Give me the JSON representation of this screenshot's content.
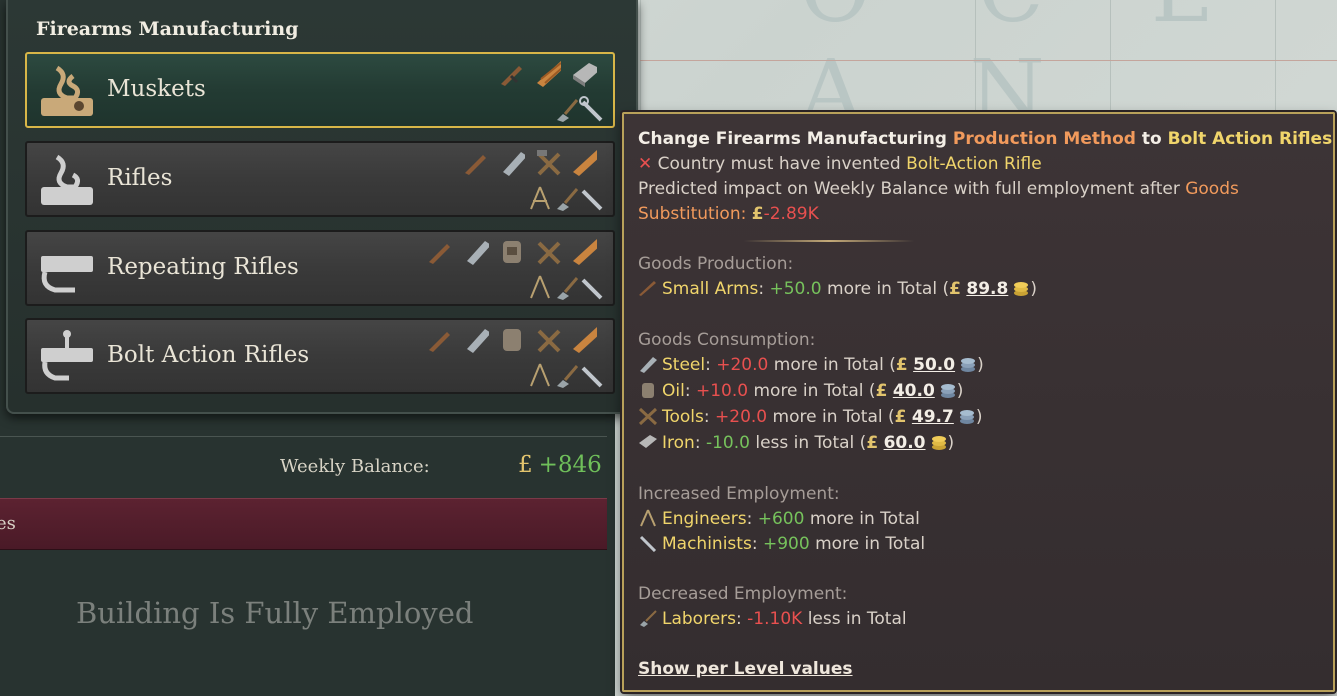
{
  "panel": {
    "title": "Firearms Manufacturing",
    "methods": [
      {
        "label": "Muskets"
      },
      {
        "label": "Rifles"
      },
      {
        "label": "Repeating Rifles"
      },
      {
        "label": "Bolt Action Rifles"
      }
    ]
  },
  "balance": {
    "label": "Weekly Balance:",
    "currency": "£",
    "value": "+846"
  },
  "maroon_text": "es",
  "employment_status": "Building Is Fully Employed",
  "tooltip": {
    "title_prefix": "Change Firearms Manufacturing",
    "title_mid": "Production Method",
    "title_to": "to",
    "title_target": "Bolt Action Rifles",
    "req_prefix": "Country must have invented",
    "req_tech": "Bolt-Action Rifle",
    "impact_text": "Predicted impact on Weekly Balance with full employment after",
    "impact_goods": "Goods",
    "impact_subst": "Substitution:",
    "impact_currency": "£",
    "impact_value": "-2.89K",
    "production_header": "Goods Production:",
    "production": [
      {
        "name": "Small Arms",
        "delta": "+50.0",
        "dir": "more in Total (",
        "currency": "£",
        "price": "89.8",
        "close": ")"
      }
    ],
    "consumption_header": "Goods Consumption:",
    "consumption": [
      {
        "name": "Steel",
        "delta": "+20.0",
        "dir": "more in Total (",
        "currency": "£",
        "price": "50.0",
        "close": ")"
      },
      {
        "name": "Oil",
        "delta": "+10.0",
        "dir": "more in Total (",
        "currency": "£",
        "price": "40.0",
        "close": ")"
      },
      {
        "name": "Tools",
        "delta": "+20.0",
        "dir": "more in Total (",
        "currency": "£",
        "price": "49.7",
        "close": ")"
      },
      {
        "name": "Iron",
        "delta": "-10.0",
        "dir": "less in Total (",
        "currency": "£",
        "price": "60.0",
        "close": ")"
      }
    ],
    "increased_header": "Increased Employment:",
    "increased": [
      {
        "name": "Engineers",
        "delta": "+600",
        "dir": "more in Total"
      },
      {
        "name": "Machinists",
        "delta": "+900",
        "dir": "more in Total"
      }
    ],
    "decreased_header": "Decreased Employment:",
    "decreased": [
      {
        "name": "Laborers",
        "delta": "-1.10K",
        "dir": "less in Total"
      }
    ],
    "show_per_level": "Show per Level values"
  },
  "colors": {
    "selected_border": "#d8b648",
    "positive": "#76c25c",
    "negative": "#e8504f",
    "highlight": "#f0d56b",
    "accent_orange": "#f19a5c"
  }
}
